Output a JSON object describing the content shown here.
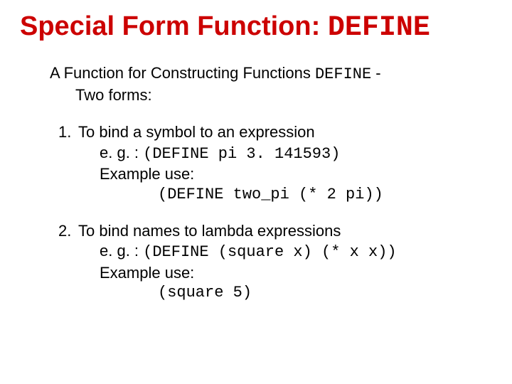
{
  "title": {
    "prefix": "Special Form Function: ",
    "keyword": "DEFINE"
  },
  "intro": {
    "line1_pre": "A Function for Constructing Functions ",
    "line1_kw": "DEFINE",
    "line1_post": " -",
    "line2": "Two forms:"
  },
  "items": [
    {
      "num": "1.",
      "head": "To bind a symbol to an expression",
      "eg_label": "e. g. : ",
      "eg_code": "(DEFINE pi 3. 141593)",
      "use_label": "Example use:",
      "use_code": "(DEFINE two_pi (* 2 pi))"
    },
    {
      "num": "2.",
      "head": "To bind names to lambda expressions",
      "eg_label": "e. g. : ",
      "eg_code": "(DEFINE (square x) (* x x))",
      "use_label": "Example use:",
      "use_code": "(square 5)"
    }
  ]
}
